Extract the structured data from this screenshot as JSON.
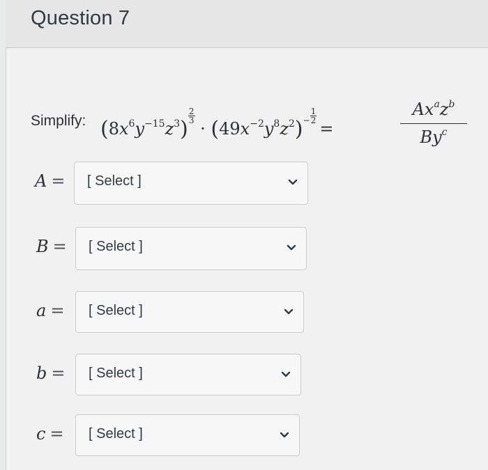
{
  "question": {
    "title": "Question 7",
    "prompt_label": "Simplify:"
  },
  "answers": [
    {
      "variable": "A",
      "equals": "=",
      "selected": "[ Select ]",
      "icon": "chevron-down-icon"
    },
    {
      "variable": "B",
      "equals": "=",
      "selected": "[ Select ]",
      "icon": "chevron-down-icon"
    },
    {
      "variable": "a",
      "equals": "=",
      "selected": "[ Select ]",
      "icon": "chevron-down-icon"
    },
    {
      "variable": "b",
      "equals": "=",
      "selected": "[ Select ]",
      "icon": "chevron-down-icon"
    },
    {
      "variable": "c",
      "equals": "=",
      "selected": "[ Select ]",
      "icon": "chevron-down-icon"
    }
  ],
  "colors": {
    "page_bg": "#f1f1f1",
    "header_bg": "#e6e6e6",
    "select_border": "#c7cdd1",
    "text": "#2d3b45"
  }
}
